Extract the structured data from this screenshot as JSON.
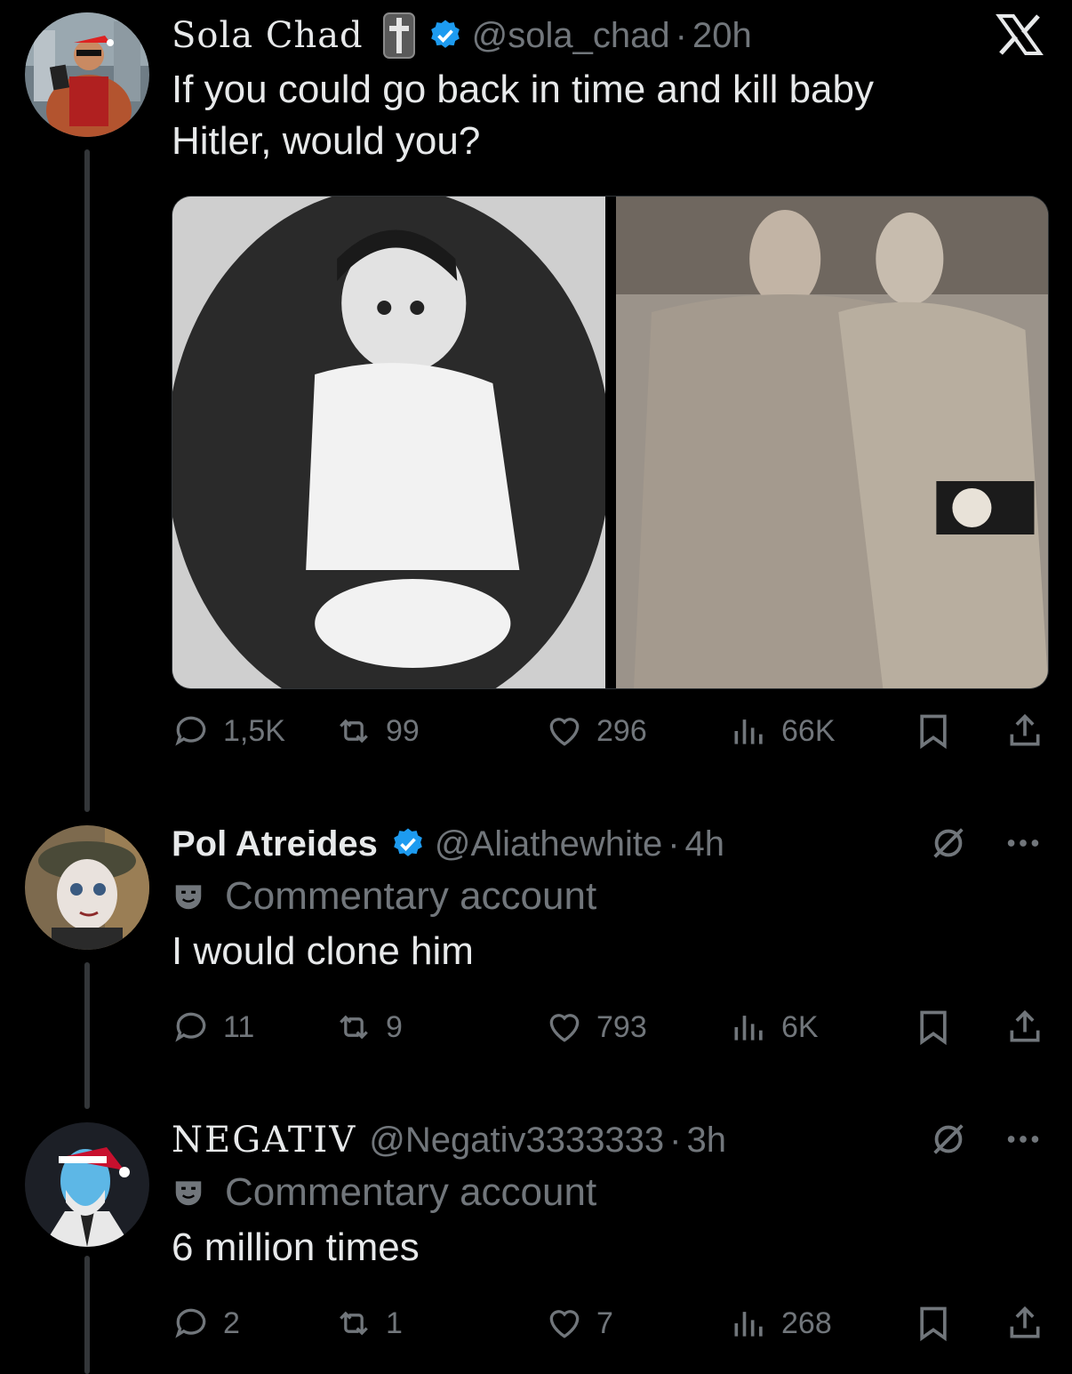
{
  "tweets": [
    {
      "name": "Sola Chad",
      "handle": "@sola_chad",
      "time": "20h",
      "text": "If you could go back in time and kill baby Hitler, would you?",
      "stats": {
        "replies": "1,5K",
        "reposts": "99",
        "likes": "296",
        "views": "66K"
      }
    },
    {
      "name": "Pol Atreides",
      "handle": "@Aliathewhite",
      "time": "4h",
      "label": "Commentary account",
      "text": "I would clone him",
      "stats": {
        "replies": "11",
        "reposts": "9",
        "likes": "793",
        "views": "6K"
      }
    },
    {
      "name": "NEGATIV",
      "handle": "@Negativ3333333",
      "time": "3h",
      "label": "Commentary account",
      "text": "6 million times",
      "stats": {
        "replies": "2",
        "reposts": "1",
        "likes": "7",
        "views": "268"
      }
    }
  ],
  "icons": {
    "brand": "x-logo-icon",
    "verified_color": "#1d9bf0",
    "muted_color": "#71767b"
  }
}
